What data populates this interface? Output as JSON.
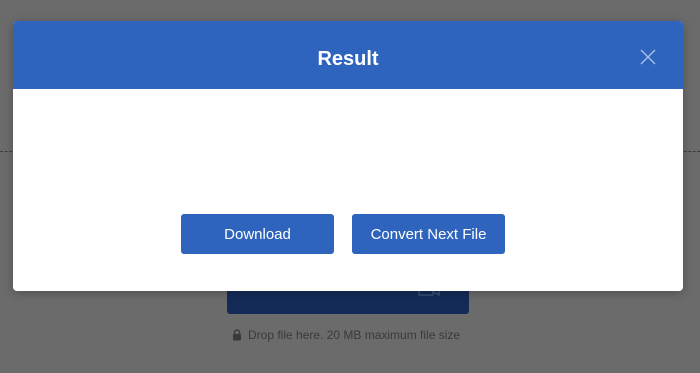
{
  "background": {
    "drop_hint": "Drop file here. 20 MB maximum file size",
    "upload_icon": "upload-icon",
    "lock_icon": "lock-icon"
  },
  "modal": {
    "title": "Result",
    "close_icon": "close-icon",
    "buttons": {
      "download": "Download",
      "convert_next": "Convert Next File"
    }
  },
  "colors": {
    "accent": "#2e64be",
    "overlay": "#6b6b6b",
    "upload_button_bg": "#142a57"
  }
}
